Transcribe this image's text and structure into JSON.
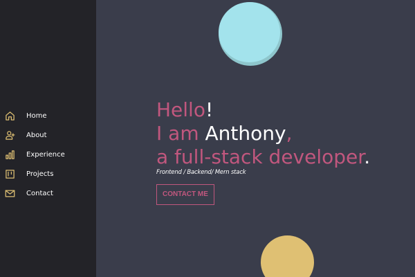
{
  "nav": {
    "items": [
      {
        "label": "Home",
        "icon": "home-icon"
      },
      {
        "label": "About",
        "icon": "user-plus-icon"
      },
      {
        "label": "Experience",
        "icon": "bar-chart-icon"
      },
      {
        "label": "Projects",
        "icon": "trello-icon"
      },
      {
        "label": "Contact",
        "icon": "mail-icon"
      }
    ]
  },
  "hero": {
    "greeting": "Hello",
    "greeting_punct": "!",
    "intro": "I am",
    "name": "Anthony",
    "name_punct": ",",
    "role": "a full-stack developer",
    "role_punct": ".",
    "subtitle": "Frontend / Backend/ Mern stack",
    "cta_label": "CONTACT ME"
  },
  "colors": {
    "accent": "#c1577e",
    "sidebar_bg": "#232328",
    "main_bg": "#3a3d4b",
    "icon": "#dfc073",
    "circle_top": "#a3e3ec",
    "circle_bottom": "#dfc073"
  }
}
